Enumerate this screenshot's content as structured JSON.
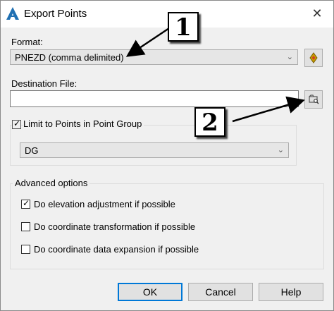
{
  "window": {
    "title": "Export Points"
  },
  "format": {
    "label": "Format:",
    "value": "PNEZD (comma delimited)"
  },
  "destination": {
    "label": "Destination File:",
    "value": ""
  },
  "limit": {
    "label": "Limit to Points in Point Group",
    "checked": true,
    "group_value": "DG"
  },
  "advanced": {
    "title": "Advanced options",
    "options": [
      {
        "label": "Do elevation adjustment if possible",
        "checked": true
      },
      {
        "label": "Do coordinate transformation if possible",
        "checked": false
      },
      {
        "label": "Do coordinate data expansion if possible",
        "checked": false
      }
    ]
  },
  "buttons": {
    "ok": "OK",
    "cancel": "Cancel",
    "help": "Help"
  },
  "callouts": {
    "one": "1",
    "two": "2"
  },
  "icons": {
    "app": "autocad-a-icon",
    "close": "close-icon",
    "format_edit": "format-editor-icon",
    "browse": "browse-folder-icon"
  },
  "colors": {
    "accent": "#0078d7",
    "app_icon": "#1f6fb2"
  }
}
